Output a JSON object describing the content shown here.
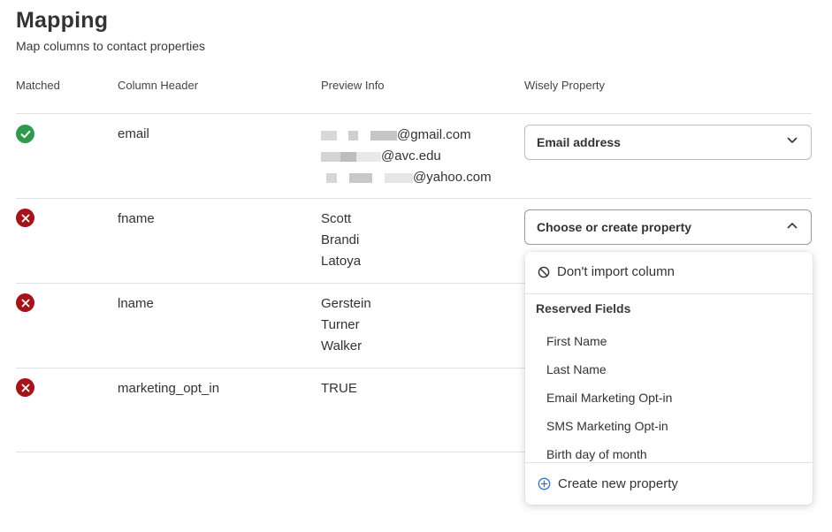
{
  "page": {
    "title": "Mapping",
    "subtitle": "Map columns to contact properties"
  },
  "table": {
    "headers": {
      "matched": "Matched",
      "column_header": "Column Header",
      "preview_info": "Preview Info",
      "wisely_property": "Wisely Property"
    },
    "rows": [
      {
        "matched": true,
        "column": "email",
        "preview": [
          "@gmail.com",
          "@avc.edu",
          "@yahoo.com"
        ],
        "property": "Email address",
        "dropdown_open": false
      },
      {
        "matched": false,
        "column": "fname",
        "preview": [
          "Scott",
          "Brandi",
          "Latoya"
        ],
        "property": "Choose or create property",
        "dropdown_open": true
      },
      {
        "matched": false,
        "column": "lname",
        "preview": [
          "Gerstein",
          "Turner",
          "Walker"
        ]
      },
      {
        "matched": false,
        "column": "marketing_opt_in",
        "preview": [
          "TRUE"
        ]
      }
    ]
  },
  "dropdown": {
    "dont_import": "Don't import column",
    "group_label": "Reserved Fields",
    "items": [
      "First Name",
      "Last Name",
      "Email Marketing Opt-in",
      "SMS Marketing Opt-in",
      "Birth day of month"
    ],
    "create_new": "Create new property"
  },
  "colors": {
    "matched_green": "#2f9a4c",
    "unmatched_red": "#a3151a",
    "create_icon_blue": "#2d6fdc"
  }
}
